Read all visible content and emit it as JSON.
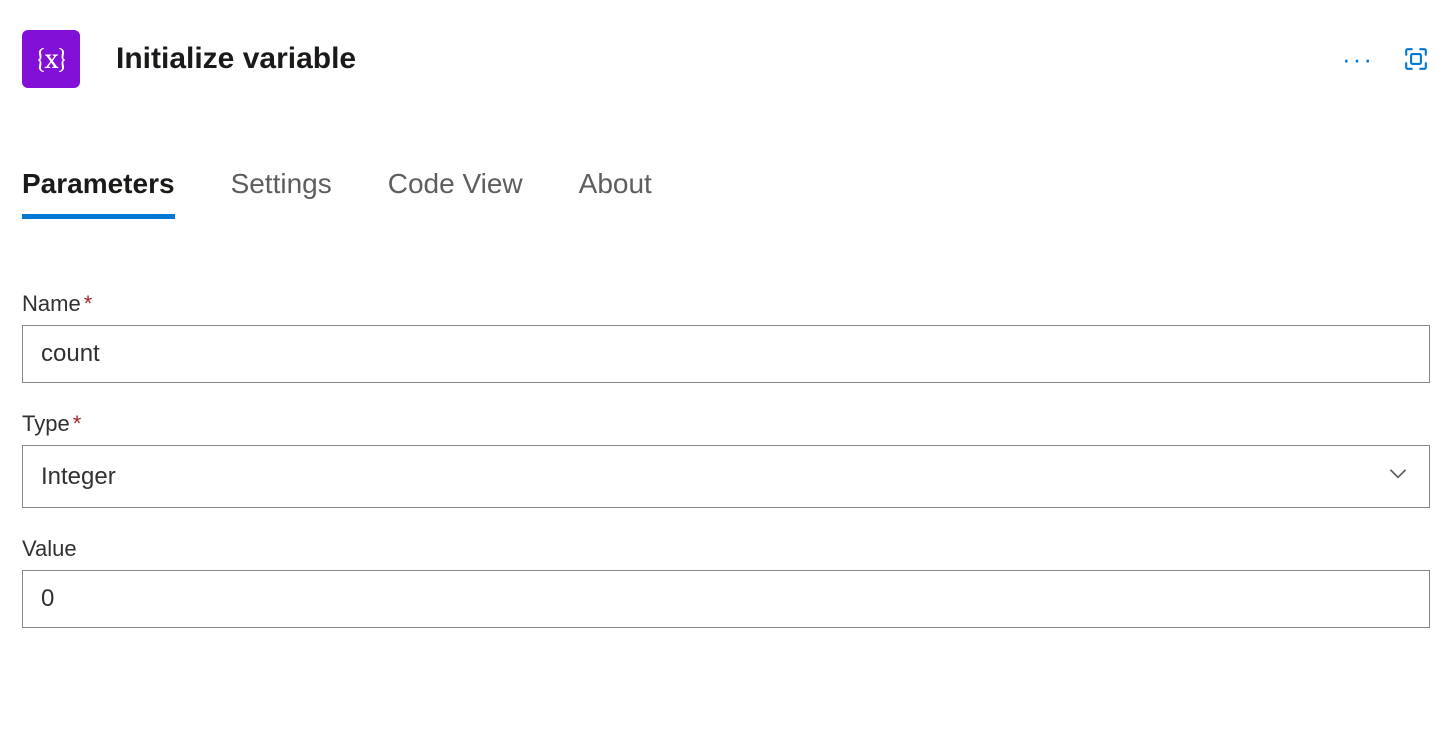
{
  "header": {
    "icon_glyph": "{x}",
    "title": "Initialize variable"
  },
  "tabs": [
    {
      "label": "Parameters",
      "active": true
    },
    {
      "label": "Settings",
      "active": false
    },
    {
      "label": "Code View",
      "active": false
    },
    {
      "label": "About",
      "active": false
    }
  ],
  "form": {
    "name": {
      "label": "Name",
      "required": true,
      "value": "count"
    },
    "type": {
      "label": "Type",
      "required": true,
      "value": "Integer"
    },
    "value": {
      "label": "Value",
      "required": false,
      "value": "0"
    }
  },
  "colors": {
    "action_bg": "#8210d6",
    "accent": "#0078d4",
    "required": "#a4262c"
  }
}
